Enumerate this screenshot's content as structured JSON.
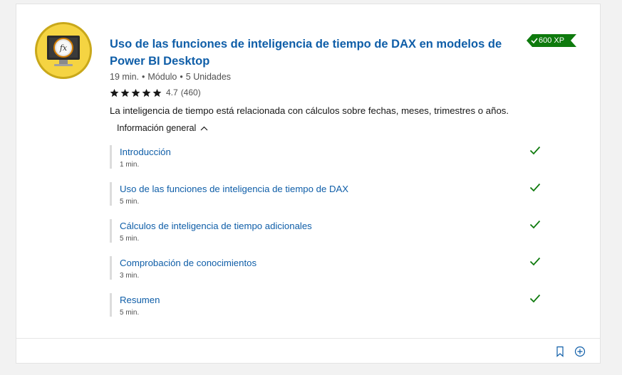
{
  "module": {
    "title": "Uso de las funciones de inteligencia de tiempo de DAX en modelos de Power BI Desktop",
    "icon": "clock-fx-monitor-icon",
    "xp": "600 XP",
    "meta": {
      "duration": "19 min.",
      "type": "Módulo",
      "units": "5 Unidades"
    },
    "rating": {
      "stars": 5,
      "score": "4.7",
      "count": "(460)"
    },
    "description": "La inteligencia de tiempo está relacionada con cálculos sobre fechas, meses, trimestres o años.",
    "overview_label": "Información general"
  },
  "units": [
    {
      "title": "Introducción",
      "duration": "1 min.",
      "completed": true
    },
    {
      "title": "Uso de las funciones de inteligencia de tiempo de DAX",
      "duration": "5 min.",
      "completed": true
    },
    {
      "title": "Cálculos de inteligencia de tiempo adicionales",
      "duration": "5 min.",
      "completed": true
    },
    {
      "title": "Comprobación de conocimientos",
      "duration": "3 min.",
      "completed": true
    },
    {
      "title": "Resumen",
      "duration": "5 min.",
      "completed": true
    }
  ],
  "colors": {
    "link": "#0f5ea8",
    "badge": "#0e7a0d",
    "check": "#0e7a0d",
    "icon_ring": "#f5d442"
  },
  "footer": {
    "bookmark_icon": "bookmark-icon",
    "add_icon": "add-circle-icon"
  }
}
